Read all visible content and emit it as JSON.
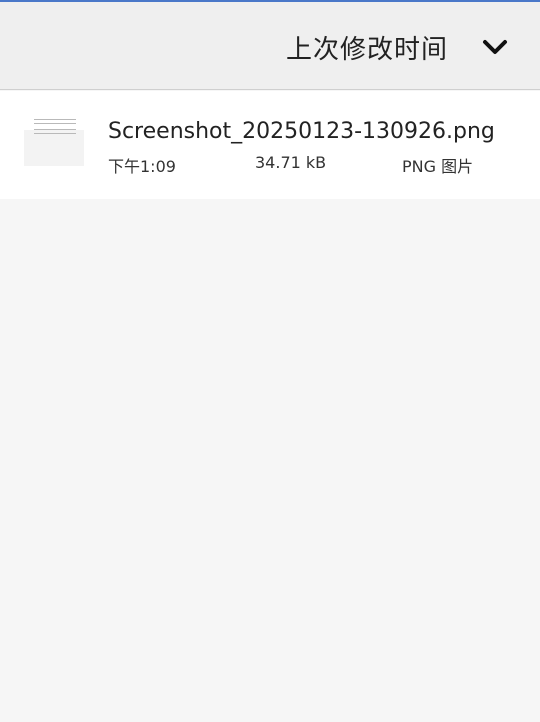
{
  "header": {
    "sort_label": "上次修改时间",
    "sort_icon": "chevron-down-icon"
  },
  "files": [
    {
      "name": "Screenshot_20250123-130926.png",
      "time": "下午1:09",
      "size": "34.71 kB",
      "type": "PNG 图片"
    }
  ],
  "colors": {
    "top_accent": "#4a78c9",
    "toolbar_bg": "#efefef",
    "list_bg": "#ffffff",
    "page_bg": "#f6f6f6"
  }
}
